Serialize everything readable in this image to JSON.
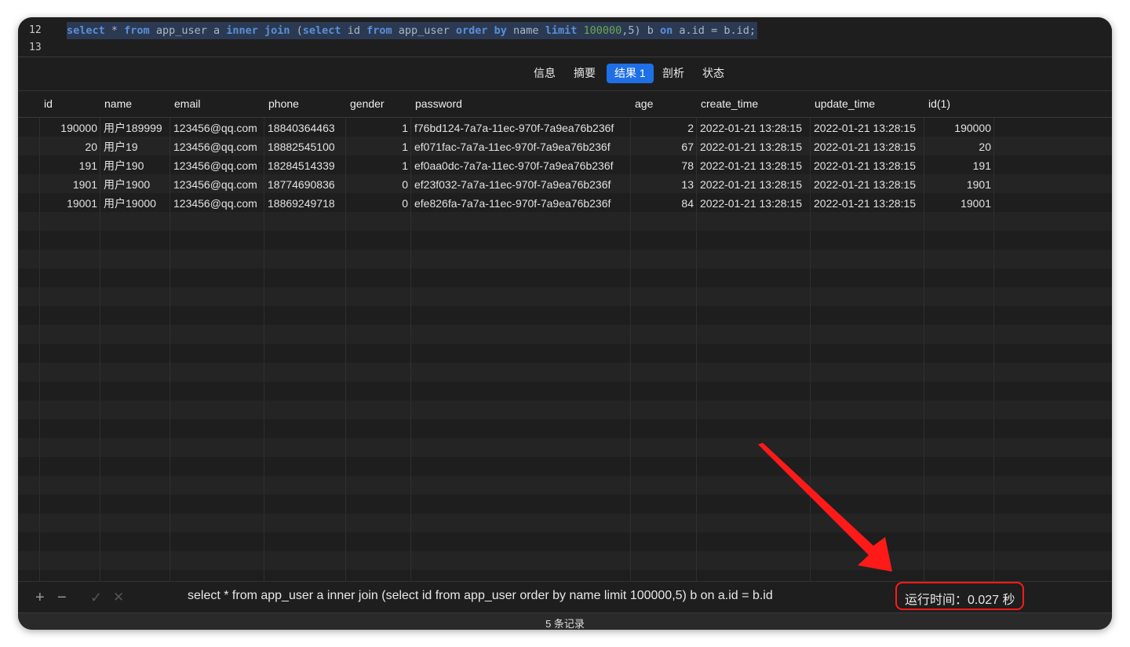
{
  "editor": {
    "lines": [
      {
        "number": "12"
      },
      {
        "number": "13"
      }
    ]
  },
  "tabs": [
    {
      "label": "信息",
      "active": false
    },
    {
      "label": "摘要",
      "active": false
    },
    {
      "label": "结果 1",
      "active": true
    },
    {
      "label": "剖析",
      "active": false
    },
    {
      "label": "状态",
      "active": false
    }
  ],
  "table": {
    "columns": [
      "id",
      "name",
      "email",
      "phone",
      "gender",
      "password",
      "age",
      "create_time",
      "update_time",
      "id(1)"
    ],
    "rows": [
      [
        "190000",
        "用户189999",
        "123456@qq.com",
        "18840364463",
        "1",
        "f76bd124-7a7a-11ec-970f-7a9ea76b236f",
        "2",
        "2022-01-21 13:28:15",
        "2022-01-21 13:28:15",
        "190000"
      ],
      [
        "20",
        "用户19",
        "123456@qq.com",
        "18882545100",
        "1",
        "ef071fac-7a7a-11ec-970f-7a9ea76b236f",
        "67",
        "2022-01-21 13:28:15",
        "2022-01-21 13:28:15",
        "20"
      ],
      [
        "191",
        "用户190",
        "123456@qq.com",
        "18284514339",
        "1",
        "ef0aa0dc-7a7a-11ec-970f-7a9ea76b236f",
        "78",
        "2022-01-21 13:28:15",
        "2022-01-21 13:28:15",
        "191"
      ],
      [
        "1901",
        "用户1900",
        "123456@qq.com",
        "18774690836",
        "0",
        "ef23f032-7a7a-11ec-970f-7a9ea76b236f",
        "13",
        "2022-01-21 13:28:15",
        "2022-01-21 13:28:15",
        "1901"
      ],
      [
        "19001",
        "用户19000",
        "123456@qq.com",
        "18869249718",
        "0",
        "efe826fa-7a7a-11ec-970f-7a9ea76b236f",
        "84",
        "2022-01-21 13:28:15",
        "2022-01-21 13:28:15",
        "19001"
      ]
    ]
  },
  "bottom_bar": {
    "add_icon": "+",
    "remove_icon": "−",
    "apply_icon": "✓",
    "discard_icon": "✕",
    "sql_text": "select * from app_user a inner join (select id from app_user order by name limit 100000,5) b on a.id = b.id",
    "runtime_text": "运行时间：0.027 秒"
  },
  "footer": {
    "record_count": "5 条记录"
  },
  "colors": {
    "window_bg": "#1e1e1e",
    "active_tab": "#1f6fe6",
    "annotation_red": "#ff1a1a",
    "keyword_blue": "#5a8fd8"
  }
}
